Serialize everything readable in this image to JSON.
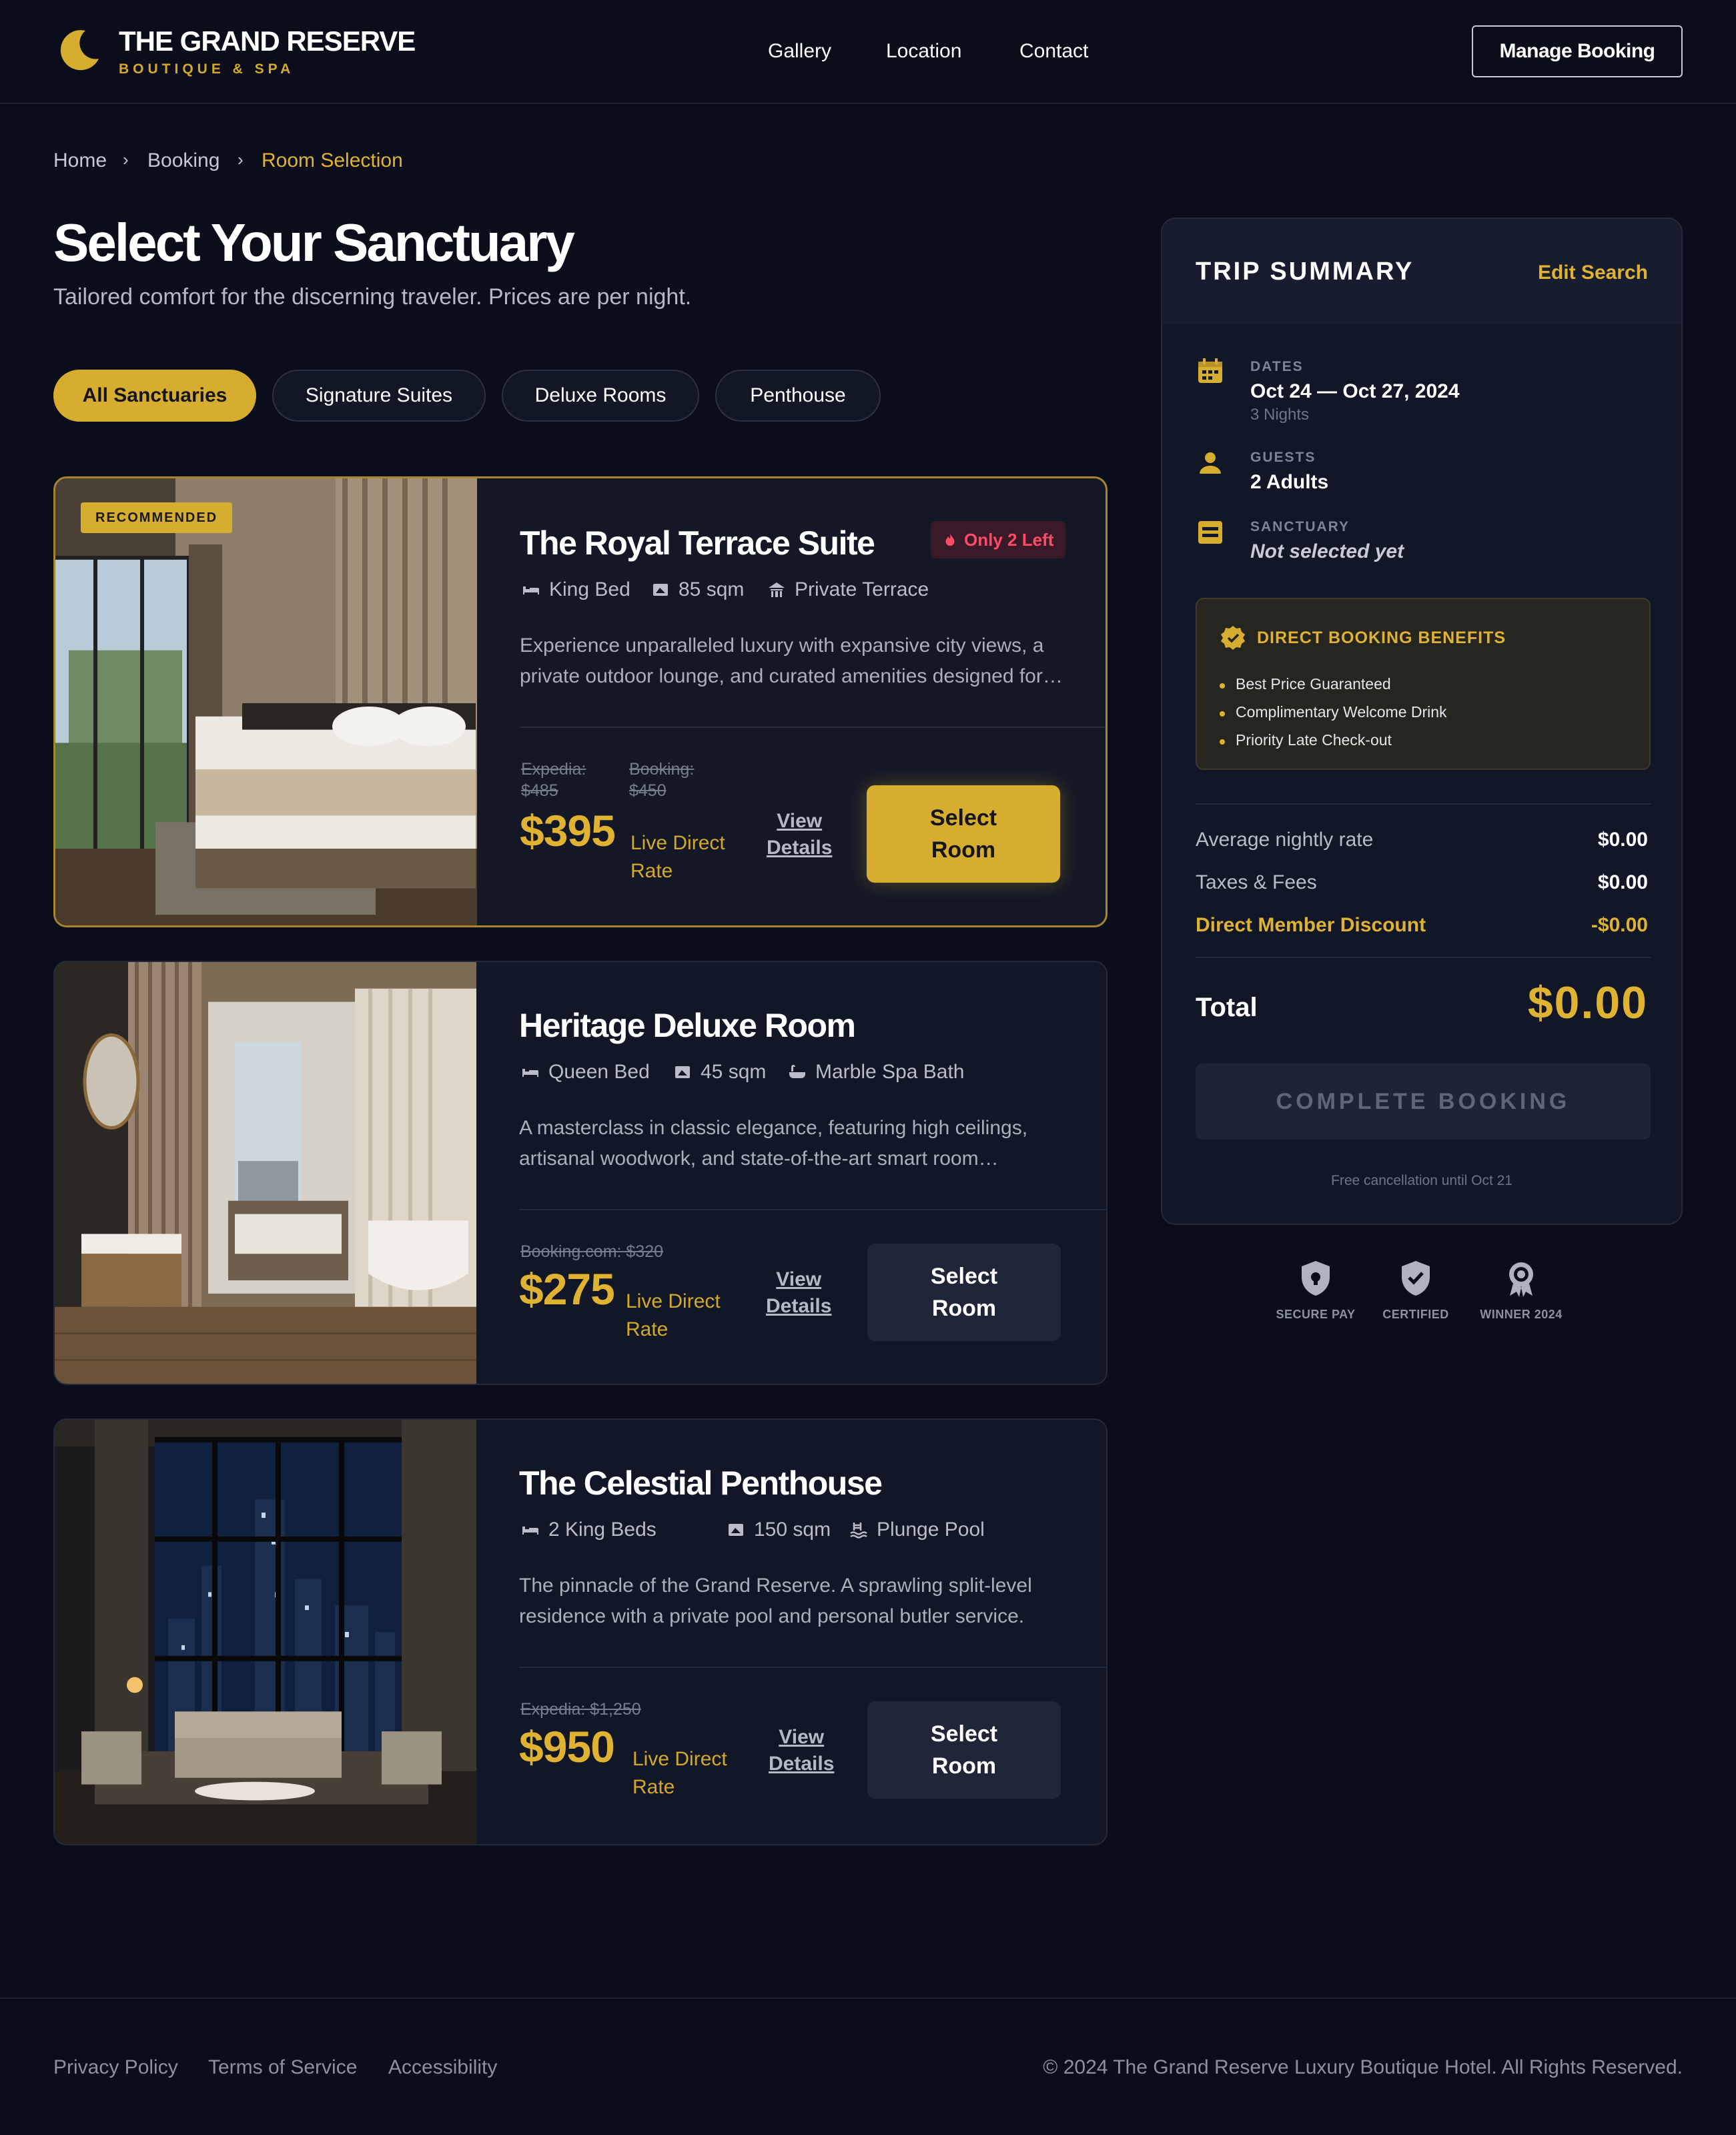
{
  "brand": {
    "name": "THE GRAND RESERVE",
    "tagline": "BOUTIQUE & SPA"
  },
  "nav": {
    "gallery": "Gallery",
    "location": "Location",
    "contact": "Contact",
    "manage": "Manage Booking"
  },
  "breadcrumb": {
    "home": "Home",
    "booking": "Booking",
    "current": "Room Selection",
    "sep": "›"
  },
  "page": {
    "title": "Select Your Sanctuary",
    "subtitle": "Tailored comfort for the discerning traveler. Prices are per night."
  },
  "filters": [
    "All Sanctuaries",
    "Signature Suites",
    "Deluxe Rooms",
    "Penthouse"
  ],
  "rooms": [
    {
      "badge": "RECOMMENDED",
      "title": "The Royal Terrace Suite",
      "scarcity": "Only 2 Left",
      "features": [
        "King Bed",
        "85 sqm",
        "Private Terrace"
      ],
      "description": "Experience unparalleled luxury with expansive city views, a private outdoor lounge, and curated amenities designed for…",
      "compare": [
        {
          "label": "Expedia:",
          "price": "$485"
        },
        {
          "label": "Booking:",
          "price": "$450"
        }
      ],
      "price": "$395",
      "rate_label": [
        "Live Direct",
        "Rate"
      ],
      "details": [
        "View",
        "Details"
      ],
      "cta": [
        "Select",
        "Room"
      ]
    },
    {
      "title": "Heritage Deluxe Room",
      "features": [
        "Queen Bed",
        "45 sqm",
        "Marble Spa Bath"
      ],
      "description": "A masterclass in classic elegance, featuring high ceilings, artisanal woodwork, and state-of-the-art smart room…",
      "compare_text": "Booking.com: $320",
      "price": "$275",
      "rate_label": [
        "Live Direct",
        "Rate"
      ],
      "details": [
        "View",
        "Details"
      ],
      "cta": [
        "Select",
        "Room"
      ]
    },
    {
      "title": "The Celestial Penthouse",
      "features": [
        "2 King Beds",
        "150 sqm",
        "Plunge Pool"
      ],
      "description": "The pinnacle of the Grand Reserve. A sprawling split-level residence with a private pool and personal butler service.",
      "compare_text": "Expedia: $1,250",
      "price": "$950",
      "rate_label": [
        "Live Direct",
        "Rate"
      ],
      "details": [
        "View",
        "Details"
      ],
      "cta": [
        "Select",
        "Room"
      ]
    }
  ],
  "summary": {
    "title": "TRIP SUMMARY",
    "edit": "Edit Search",
    "dates_label": "DATES",
    "dates_value": "Oct 24 — Oct 27, 2024",
    "nights": "3 Nights",
    "guests_label": "GUESTS",
    "guests_value": "2 Adults",
    "sanctuary_label": "SANCTUARY",
    "sanctuary_value": "Not selected yet",
    "benefits_title": "DIRECT BOOKING BENEFITS",
    "benefits": [
      "Best Price Guaranteed",
      "Complimentary Welcome Drink",
      "Priority Late Check-out"
    ],
    "avg_label": "Average nightly rate",
    "avg_value": "$0.00",
    "tax_label": "Taxes & Fees",
    "tax_value": "$0.00",
    "discount_label": "Direct Member Discount",
    "discount_value": "-$0.00",
    "total_label": "Total",
    "total_value": "$0.00",
    "cta": "COMPLETE BOOKING",
    "note": "Free cancellation until Oct 21"
  },
  "trust": [
    "SECURE PAY",
    "CERTIFIED",
    "WINNER 2024"
  ],
  "footer": {
    "privacy": "Privacy Policy",
    "terms": "Terms of Service",
    "accessibility": "Accessibility",
    "copyright": "© 2024 The Grand Reserve Luxury Boutique Hotel. All Rights Reserved."
  },
  "colors": {
    "accent": "#d7ad2f",
    "background": "#0b0e1a",
    "card": "#121727",
    "alert": "#ff4b68"
  }
}
